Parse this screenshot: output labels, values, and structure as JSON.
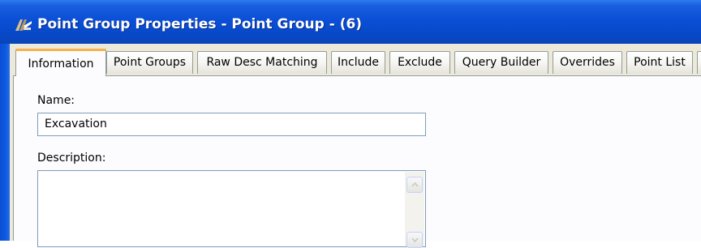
{
  "window": {
    "title": "Point Group Properties - Point Group - (6)"
  },
  "tabs": [
    {
      "label": "Information",
      "active": true
    },
    {
      "label": "Point Groups",
      "active": false
    },
    {
      "label": "Raw Desc Matching",
      "active": false
    },
    {
      "label": "Include",
      "active": false
    },
    {
      "label": "Exclude",
      "active": false
    },
    {
      "label": "Query Builder",
      "active": false
    },
    {
      "label": "Overrides",
      "active": false
    },
    {
      "label": "Point List",
      "active": false
    }
  ],
  "form": {
    "name_label": "Name:",
    "name_value": "Excavation",
    "description_label": "Description:",
    "description_value": ""
  },
  "icons": {
    "app_icon": "civil3d-app-icon",
    "scroll_up": "scroll-up-arrow-icon",
    "scroll_down": "scroll-down-arrow-icon"
  },
  "colors": {
    "titlebar": "#0a4fd6",
    "active_tab_accent": "#f5b04a",
    "client_background": "#ece9d8"
  }
}
